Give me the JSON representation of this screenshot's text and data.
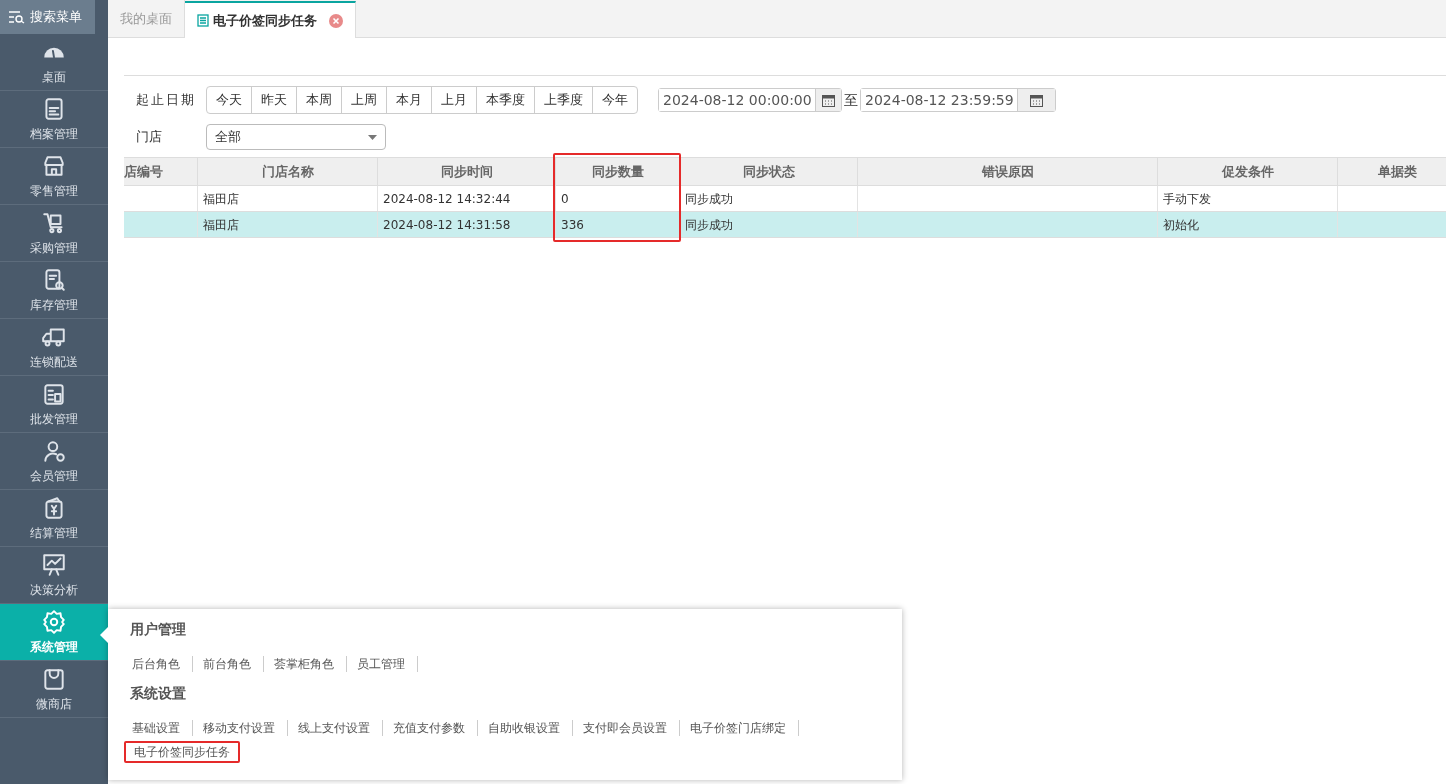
{
  "sidebar": {
    "search_label": "搜索菜单",
    "items": [
      {
        "label": "桌面",
        "selected": false
      },
      {
        "label": "档案管理",
        "selected": false
      },
      {
        "label": "零售管理",
        "selected": false
      },
      {
        "label": "采购管理",
        "selected": false
      },
      {
        "label": "库存管理",
        "selected": false
      },
      {
        "label": "连锁配送",
        "selected": false
      },
      {
        "label": "批发管理",
        "selected": false
      },
      {
        "label": "会员管理",
        "selected": false
      },
      {
        "label": "结算管理",
        "selected": false
      },
      {
        "label": "决策分析",
        "selected": false
      },
      {
        "label": "系统管理",
        "selected": true
      },
      {
        "label": "微商店",
        "selected": false
      }
    ]
  },
  "tabs": [
    {
      "label": "我的桌面",
      "selected": false
    },
    {
      "label": "电子价签同步任务",
      "selected": true
    }
  ],
  "filters": {
    "date_label": "起止日期",
    "quick_ranges": [
      "今天",
      "昨天",
      "本周",
      "上周",
      "本月",
      "上月",
      "本季度",
      "上季度",
      "今年"
    ],
    "start": "2024-08-12 00:00:00",
    "separator": "至",
    "end": "2024-08-12 23:59:59",
    "store_label": "门店",
    "store_value": "全部"
  },
  "table": {
    "columns": [
      {
        "label": "店编号",
        "highlighted": false
      },
      {
        "label": "门店名称",
        "highlighted": false
      },
      {
        "label": "同步时间",
        "highlighted": false
      },
      {
        "label": "同步数量",
        "highlighted": true
      },
      {
        "label": "同步状态",
        "highlighted": false
      },
      {
        "label": "错误原因",
        "highlighted": false
      },
      {
        "label": "促发条件",
        "highlighted": false
      },
      {
        "label": "单据类",
        "highlighted": false
      }
    ],
    "rows": [
      {
        "selected": false,
        "cells": [
          "",
          "福田店",
          "2024-08-12 14:32:44",
          "0",
          "同步成功",
          "",
          "手动下发",
          ""
        ]
      },
      {
        "selected": true,
        "cells": [
          "",
          "福田店",
          "2024-08-12 14:31:58",
          "336",
          "同步成功",
          "",
          "初始化",
          ""
        ]
      }
    ]
  },
  "popup_menu": {
    "sections": [
      {
        "title": "用户管理",
        "items": [
          {
            "label": "后台角色",
            "highlighted": false
          },
          {
            "label": "前台角色",
            "highlighted": false
          },
          {
            "label": "荟掌柜角色",
            "highlighted": false
          },
          {
            "label": "员工管理",
            "highlighted": false
          }
        ]
      },
      {
        "title": "系统设置",
        "items": [
          {
            "label": "基础设置",
            "highlighted": false
          },
          {
            "label": "移动支付设置",
            "highlighted": false
          },
          {
            "label": "线上支付设置",
            "highlighted": false
          },
          {
            "label": "充值支付参数",
            "highlighted": false
          },
          {
            "label": "自助收银设置",
            "highlighted": false
          },
          {
            "label": "支付即会员设置",
            "highlighted": false
          },
          {
            "label": "电子价签门店绑定",
            "highlighted": false
          },
          {
            "label": "电子价签同步任务",
            "highlighted": true
          }
        ]
      }
    ]
  }
}
